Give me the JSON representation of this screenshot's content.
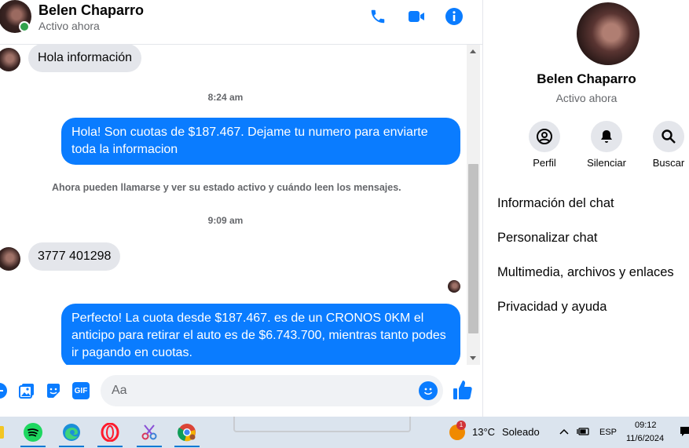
{
  "header": {
    "name": "Belen Chaparro",
    "status": "Activo ahora",
    "icons": [
      "phone-icon",
      "video-icon",
      "info-icon"
    ]
  },
  "messages": {
    "m1": "Hola información",
    "t1": "8:24 am",
    "m2": "Hola! Son cuotas de $187.467. Dejame tu numero para enviarte toda la informacion",
    "note": "Ahora pueden llamarse y ver su estado activo y cuándo leen los mensajes.",
    "t2": "9:09 am",
    "m3": "3777 401298",
    "m4": "Perfecto! La cuota desde $187.467. es de un CRONOS 0KM el anticipo para retirar el auto es de $6.743.700, mientras tanto podes ir pagando en cuotas."
  },
  "composer": {
    "placeholder": "Aa",
    "gif_label": "GIF"
  },
  "panel": {
    "name": "Belen Chaparro",
    "status": "Activo ahora",
    "actions": [
      {
        "label": "Perfil",
        "icon": "profile-icon"
      },
      {
        "label": "Silenciar",
        "icon": "bell-icon"
      },
      {
        "label": "Buscar",
        "icon": "search-icon"
      }
    ],
    "menu": [
      "Información del chat",
      "Personalizar chat",
      "Multimedia, archivos y enlaces",
      "Privacidad y ayuda"
    ]
  },
  "taskbar": {
    "weather_badge": "1",
    "temperature": "13°C",
    "weather": "Soleado",
    "language": "ESP",
    "time": "09:12",
    "date": "11/6/2024"
  },
  "colors": {
    "accent": "#0a7cff",
    "incoming_bubble": "#e4e6eb",
    "online": "#31a24c"
  }
}
